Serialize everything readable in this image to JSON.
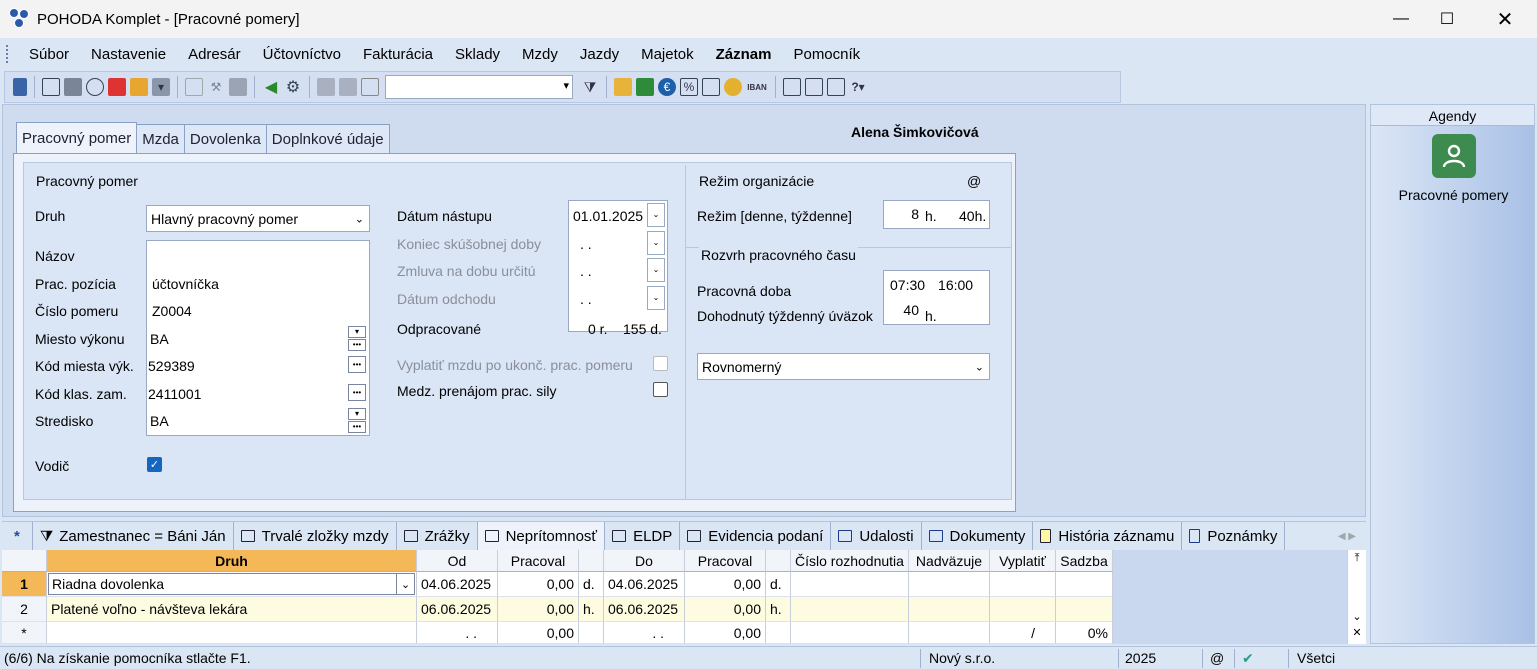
{
  "window": {
    "title": "POHODA Komplet - [Pracovné pomery]"
  },
  "menu": [
    "Súbor",
    "Nastavenie",
    "Adresár",
    "Účtovníctvo",
    "Fakturácia",
    "Sklady",
    "Mzdy",
    "Jazdy",
    "Majetok",
    "Záznam",
    "Pomocník"
  ],
  "toolbar": {
    "iban_label": "IBAN"
  },
  "tabs": [
    "Pracovný pomer",
    "Mzda",
    "Dovolenka",
    "Doplnkové údaje"
  ],
  "employee_name": "Alena Šimkovičová",
  "employment": {
    "section_title": "Pracovný pomer",
    "druh_label": "Druh",
    "druh_value": "Hlavný pracovný pomer",
    "nazov_label": "Názov",
    "nazov_value": "",
    "pozicia_label": "Prac. pozícia",
    "pozicia_value": "účtovníčka",
    "cislo_label": "Číslo pomeru",
    "cislo_value": "Z0004",
    "miesto_label": "Miesto výkonu",
    "miesto_value": "BA",
    "kod_miesta_label": "Kód miesta výk.",
    "kod_miesta_value": "529389",
    "kod_klas_label": "Kód klas. zam.",
    "kod_klas_value": "2411001",
    "stredisko_label": "Stredisko",
    "stredisko_value": "BA",
    "vodic_label": "Vodič"
  },
  "dates": {
    "nastup_label": "Dátum nástupu",
    "nastup_value": "01.01.2025",
    "skusobna_label": "Koniec skúšobnej doby",
    "skusobna_value": ". .",
    "zmluva_label": "Zmluva na dobu určitú",
    "zmluva_value": ". .",
    "odchod_label": "Dátum odchodu",
    "odchod_value": ". .",
    "odpracovane_label": "Odpracované",
    "odpracovane_r": "0 r.",
    "odpracovane_d": "155 d.",
    "vyplatit_label": "Vyplatiť mzdu po ukonč. prac. pomeru",
    "medz_label": "Medz. prenájom prac. sily"
  },
  "regime": {
    "title": "Režim organizácie",
    "at_sign": "@",
    "rezim_label": "Režim  [denne, týždenne]",
    "denne": "8",
    "denne_unit": "h.",
    "tyzdenne": "40h.",
    "rozvrh_title": "Rozvrh pracovného času",
    "doba_label": "Pracovná doba",
    "doba_od": "07:30",
    "doba_do": "16:00",
    "uvazok_label": "Dohodnutý týždenný úväzok",
    "uvazok_value": "40",
    "uvazok_unit": "h.",
    "rozvrh_value": "Rovnomerný"
  },
  "agendy": {
    "title": "Agendy",
    "item": "Pracovné pomery"
  },
  "bottom_tabs": [
    "Zamestnanec = Báni Ján",
    "Trvalé zložky mzdy",
    "Zrážky",
    "Neprítomnosť",
    "ELDP",
    "Evidencia podaní",
    "Udalosti",
    "Dokumenty",
    "História záznamu",
    "Poznámky"
  ],
  "bottom_tab_star": "*",
  "grid": {
    "columns": [
      "Druh",
      "Od",
      "Pracoval",
      "Do",
      "Pracoval",
      "Číslo rozhodnutia",
      "Nadväzuje",
      "Vyplatiť",
      "Sadzba"
    ],
    "rows": [
      {
        "num": "1",
        "druh": "Riadna dovolenka",
        "od": "04.06.2025",
        "prac1": "0,00",
        "u1": "d.",
        "do": "04.06.2025",
        "prac2": "0,00",
        "u2": "d."
      },
      {
        "num": "2",
        "druh": "Platené voľno - návšteva lekára",
        "od": "06.06.2025",
        "prac1": "0,00",
        "u1": "h.",
        "do": "06.06.2025",
        "prac2": "0,00",
        "u2": "h."
      }
    ],
    "new_row": {
      "num": "*",
      "od": ". .",
      "prac1": "0,00",
      "do": ". .",
      "prac2": "0,00",
      "vyplatit": "/",
      "sadzba": "0%"
    }
  },
  "status": {
    "hint": "(6/6) Na získanie pomocníka stlačte F1.",
    "company": "Nový s.r.o.",
    "year": "2025",
    "at": "@",
    "filter": "Všetci"
  }
}
